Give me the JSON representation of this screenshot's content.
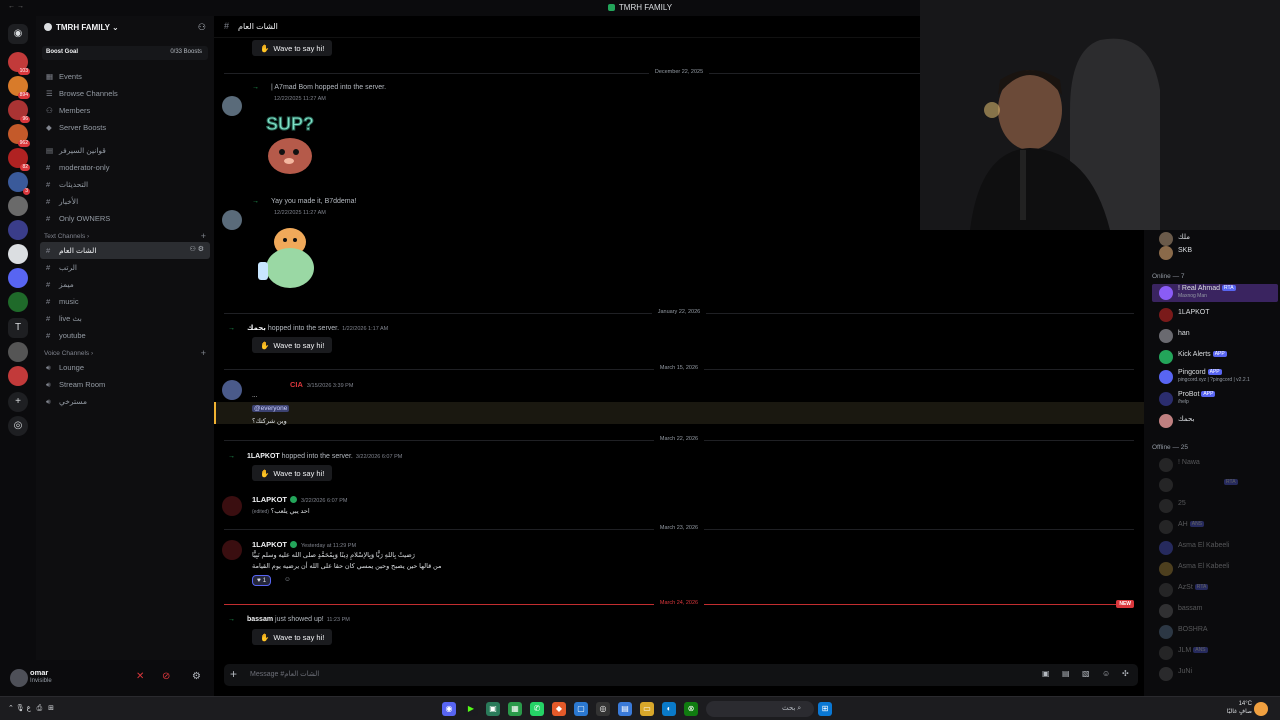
{
  "window": {
    "title": "TMRH FAMILY"
  },
  "rail": {
    "badges": [
      "103",
      "894",
      "96",
      "962",
      "82",
      "3"
    ]
  },
  "guild": {
    "name": "TMRH FAMILY",
    "boost_label": "Boost Goal",
    "boost_count": "0/33 Boosts"
  },
  "nav": {
    "events": "Events",
    "browse": "Browse Channels",
    "members": "Members",
    "boosts": "Server Boosts"
  },
  "top_channels": [
    "قوانين السيرفر",
    "moderator-only",
    "التحديثات",
    "الأخبار",
    "Only OWNERS"
  ],
  "text_category": "Text Channels",
  "text_channels": [
    "الشات العام",
    "الرتب",
    "ميمز",
    "music",
    "live بث",
    "youtube"
  ],
  "voice_category": "Voice Channels",
  "voice_channels": [
    "Lounge",
    "Stream Room",
    "مسترخي"
  ],
  "user": {
    "name": "omar",
    "status": "Invisible"
  },
  "chat": {
    "channel_name": "الشات العام",
    "wave_label": "Wave to say hi!",
    "dates": {
      "d1": "December 22, 2025",
      "d2": "January 22, 2026",
      "d3": "March 15, 2026",
      "d4": "March 22, 2026",
      "d5": "March 23, 2026",
      "d6": "March 24, 2026"
    },
    "new_label": "NEW",
    "m1": {
      "text_pre": "| A7mad Bom",
      "text_mid": "hopped into the server.",
      "ts": "12/22/2025 11:27 AM"
    },
    "m2": {
      "text": "Yay you made it, B7ddema!",
      "ts": "12/22/2025 11:27 AM"
    },
    "m3": {
      "name": "بحمك",
      "text": "hopped into the server.",
      "ts": "1/22/2026 1:17 AM"
    },
    "m4": {
      "role": "CIA",
      "ts": "3/15/2026 3:39 PM",
      "line1": "...",
      "mention": "@everyone",
      "line2": "وين شركتك؟"
    },
    "m5": {
      "name": "1LAPKOT",
      "text": "hopped into the server.",
      "ts": "3/22/2026 6:07 PM"
    },
    "m6": {
      "name": "1LAPKOT",
      "ts": "3/22/2026 6:07 PM",
      "line1": "احد يبي يلعب؟",
      "edited": "(edited)"
    },
    "m7": {
      "name": "1LAPKOT",
      "ts": "Yesterday at 11:29 PM",
      "line1": "رَضيتُ بِاللهِ رَبًّا وَبِالإسْلامِ دِينًا وَبِمُحَمَّدٍ صلى الله عليه وسلم نَبِيًّا",
      "line2": "من قالها حين يصبح وحين يمسي كان حقا على الله أن يرضيه يوم القيامة",
      "reaction_count": "1"
    },
    "m8": {
      "name": "bassam",
      "text": "just showed up!",
      "ts": "11:23 PM"
    },
    "composer_placeholder": "Message #الشات العام"
  },
  "members": {
    "top_rows": [
      {
        "name": "ملك",
        "sub": ""
      },
      {
        "name": "SKB",
        "sub": ""
      }
    ],
    "online_header": "Online — 7",
    "online": [
      {
        "name": "! Real Ahmad",
        "tag": "RTA",
        "sub": "Maxnog Man",
        "color": "#8a5cf6"
      },
      {
        "name": "1LAPKOT",
        "tag": "",
        "sub": "",
        "color": "#7a1a1a"
      },
      {
        "name": "han",
        "tag": "",
        "sub": "",
        "color": "#6a6a70"
      },
      {
        "name": "Kick Alerts",
        "tag": "APP",
        "sub": "",
        "color": "#23a55a"
      },
      {
        "name": "Pingcord",
        "tag": "APP",
        "sub": "pingcord.xyz | ?pingcord | v2.2.1",
        "color": "#5865f2"
      },
      {
        "name": "ProBot",
        "tag": "APP",
        "sub": "/help",
        "color": "#2b2d6e"
      },
      {
        "name": "بحمك",
        "tag": "",
        "sub": "",
        "color": "#c08080"
      }
    ],
    "offline_header": "Offline — 25",
    "offline": [
      {
        "name": "! Nawa",
        "tag": ""
      },
      {
        "name": "",
        "tag": "RTA"
      },
      {
        "name": "25",
        "tag": ""
      },
      {
        "name": "AH",
        "tag": "ANS"
      },
      {
        "name": "Asma El Kabeeli",
        "tag": ""
      },
      {
        "name": "Asma El Kabeeli",
        "tag": ""
      },
      {
        "name": "AzSt",
        "tag": "RTA"
      },
      {
        "name": "bassam",
        "tag": ""
      },
      {
        "name": "BOSHRA",
        "tag": ""
      },
      {
        "name": "JLM",
        "tag": "ANS"
      },
      {
        "name": "JuNi",
        "tag": ""
      }
    ]
  },
  "taskbar": {
    "search": "بحث",
    "time": "٨:٣٣ م",
    "date": "٢٧/٠٣/٠٨",
    "temp": "14°C",
    "weather_label": "صافٍ غالبًا"
  },
  "colors": {
    "accent": "#5865f2",
    "online": "#23a55a",
    "alert": "#da373c"
  }
}
